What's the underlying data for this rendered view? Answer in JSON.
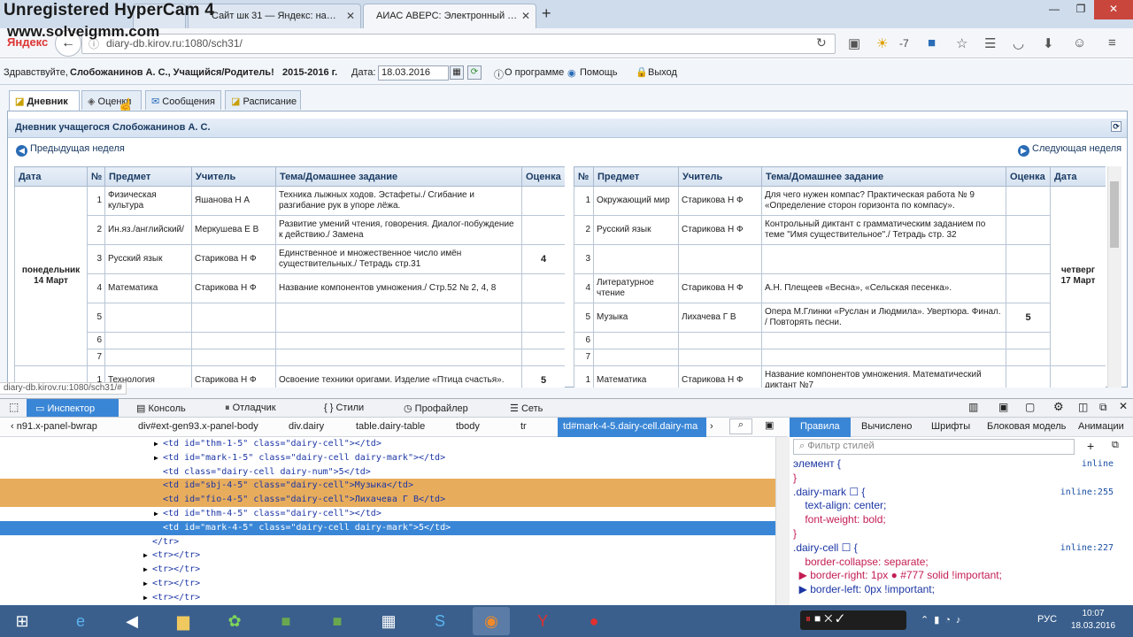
{
  "watermark": {
    "line1": "Unregistered HyperCam 4",
    "line2": "www.solveigmm.com"
  },
  "browser": {
    "tabs": [
      {
        "label": "",
        "active": false
      },
      {
        "label": "Сайт шк 31 — Яндекс: на…",
        "active": false
      },
      {
        "label": "АИАС АВЕРС: Электронный …",
        "active": true
      }
    ],
    "new_tab": "+",
    "url": "diary-db.kirov.ru:1080/sch31/",
    "weather_temp": "-7",
    "yandex_label": "Яндекс"
  },
  "app": {
    "greeting_prefix": "Здравствуйте,",
    "user": "Слобожанинов А. С., Учащийся/Родитель!",
    "year": "2015-2016 г.",
    "date_label": "Дата:",
    "date_value": "18.03.2016",
    "about": "О программе",
    "help": "Помощь",
    "logout": "Выход",
    "tabs": [
      "Дневник",
      "Оценки",
      "Сообщения",
      "Расписание"
    ],
    "panel_title": "Дневник учащегося Слобожанинов А. С.",
    "prev_week": "Предыдущая неделя",
    "next_week": "Следующая неделя",
    "status_url": "diary-db.kirov.ru:1080/sch31/#"
  },
  "diary_left": {
    "headers": [
      "Дата",
      "№",
      "Предмет",
      "Учитель",
      "Тема/Домашнее задание",
      "Оценка"
    ],
    "day": "понедельник\n14 Март",
    "rows": [
      {
        "n": "1",
        "subject": "Физическая культура",
        "teacher": "Яшанова Н А",
        "topic": "Техника лыжных ходов. Эстафеты./ Сгибание и разгибание рук в упоре лёжа.",
        "mark": ""
      },
      {
        "n": "2",
        "subject": "Ин.яз./английский/",
        "teacher": "Меркушева Е В",
        "topic": "Развитие умений чтения, говорения. Диалог-побуждение к действию./ Замена",
        "mark": ""
      },
      {
        "n": "3",
        "subject": "Русский язык",
        "teacher": "Старикова Н Ф",
        "topic": "Единственное и множественное число имён существительных./ Тетрадь стр.31",
        "mark": "4"
      },
      {
        "n": "4",
        "subject": "Математика",
        "teacher": "Старикова Н Ф",
        "topic": "Название компонентов умножения./ Стр.52 № 2, 4, 8",
        "mark": ""
      },
      {
        "n": "5",
        "subject": "",
        "teacher": "",
        "topic": "",
        "mark": ""
      },
      {
        "n": "6",
        "subject": "",
        "teacher": "",
        "topic": "",
        "mark": ""
      },
      {
        "n": "7",
        "subject": "",
        "teacher": "",
        "topic": "",
        "mark": ""
      }
    ],
    "next_row": {
      "n": "1",
      "subject": "Технология",
      "teacher": "Старикова Н Ф",
      "topic": "Освоение техники оригами. Изделие «Птица счастья».",
      "mark": "5"
    }
  },
  "diary_right": {
    "headers": [
      "№",
      "Предмет",
      "Учитель",
      "Тема/Домашнее задание",
      "Оценка",
      "Дата"
    ],
    "day": "четверг\n17 Март",
    "rows": [
      {
        "n": "1",
        "subject": "Окружающий мир",
        "teacher": "Старикова Н Ф",
        "topic": "Для чего нужен компас? Практическая работа № 9 «Определение сторон горизонта по компасу».",
        "mark": ""
      },
      {
        "n": "2",
        "subject": "Русский язык",
        "teacher": "Старикова Н Ф",
        "topic": "Контрольный диктант с грамматическим заданием по теме \"Имя существительное\"./ Тетрадь стр. 32",
        "mark": ""
      },
      {
        "n": "3",
        "subject": "",
        "teacher": "",
        "topic": "",
        "mark": ""
      },
      {
        "n": "4",
        "subject": "Литературное чтение",
        "teacher": "Старикова Н Ф",
        "topic": "А.Н. Плещеев «Весна», «Сельская песенка».",
        "mark": ""
      },
      {
        "n": "5",
        "subject": "Музыка",
        "teacher": "Лихачева Г В",
        "topic": "Опера М.Глинки «Руслан и Людмила». Увертюра. Финал. / Повторять песни.",
        "mark": "5"
      },
      {
        "n": "6",
        "subject": "",
        "teacher": "",
        "topic": "",
        "mark": ""
      },
      {
        "n": "7",
        "subject": "",
        "teacher": "",
        "topic": "",
        "mark": ""
      }
    ],
    "next_row": {
      "n": "1",
      "subject": "Математика",
      "teacher": "Старикова Н Ф",
      "topic": "Название компонентов умножения. Математический диктант №7",
      "mark": ""
    }
  },
  "devtools": {
    "tabs": [
      "Инспектор",
      "Консоль",
      "Отладчик",
      "Стили",
      "Профайлер",
      "Сеть"
    ],
    "breadcrumbs": [
      "n91.x-panel-bwrap",
      "div#ext-gen93.x-panel-body",
      "div.dairy",
      "table.dairy-table",
      "tbody",
      "tr",
      "td#mark-4-5.dairy-cell.dairy-ma"
    ],
    "html_lines": [
      {
        "indent": 2,
        "arrow": "▶",
        "text": "<td id=\"thm-1-5\" class=\"dairy-cell\"></td>",
        "style": ""
      },
      {
        "indent": 2,
        "arrow": "▶",
        "text": "<td id=\"mark-1-5\" class=\"dairy-cell dairy-mark\"></td>",
        "style": ""
      },
      {
        "indent": 2,
        "arrow": "",
        "text": "<td class=\"dairy-cell dairy-num\">5</td>",
        "style": ""
      },
      {
        "indent": 2,
        "arrow": "",
        "text": "<td id=\"sbj-4-5\" class=\"dairy-cell\">Музыка</td>",
        "style": "orange"
      },
      {
        "indent": 2,
        "arrow": "",
        "text": "<td id=\"fio-4-5\" class=\"dairy-cell\">Лихачева Г В</td>",
        "style": "orange"
      },
      {
        "indent": 2,
        "arrow": "▶",
        "text": "<td id=\"thm-4-5\" class=\"dairy-cell\"></td>",
        "style": ""
      },
      {
        "indent": 2,
        "arrow": "",
        "text": "<td id=\"mark-4-5\" class=\"dairy-cell dairy-mark\">5</td>",
        "style": "blue"
      },
      {
        "indent": 1,
        "arrow": "",
        "text": "</tr>",
        "style": ""
      },
      {
        "indent": 1,
        "arrow": "▶",
        "text": "<tr></tr>",
        "style": ""
      },
      {
        "indent": 1,
        "arrow": "▶",
        "text": "<tr></tr>",
        "style": ""
      },
      {
        "indent": 1,
        "arrow": "▶",
        "text": "<tr></tr>",
        "style": ""
      },
      {
        "indent": 1,
        "arrow": "▶",
        "text": "<tr></tr>",
        "style": ""
      }
    ],
    "right_tabs": [
      "Правила",
      "Вычислено",
      "Шрифты",
      "Блоковая модель",
      "Анимации"
    ],
    "filter_placeholder": "Фильтр стилей",
    "css_lines": [
      {
        "text": "элемент {",
        "ref": "inline"
      },
      {
        "text": "}",
        "ref": ""
      },
      {
        "text": ".dairy-mark ☐ {",
        "ref": "inline:255"
      },
      {
        "text": "    text-align: center;",
        "ref": ""
      },
      {
        "text": "    font-weight: bold;",
        "ref": ""
      },
      {
        "text": "}",
        "ref": ""
      },
      {
        "text": ".dairy-cell ☐ {",
        "ref": "inline:227"
      },
      {
        "text": "    border-collapse: separate;",
        "ref": ""
      },
      {
        "text": "  ▶ border-right: 1px ● #777 solid !important;",
        "ref": ""
      },
      {
        "text": "  ▶ border-left: 0px !important;",
        "ref": ""
      }
    ]
  },
  "taskbar": {
    "lang": "РУС",
    "time": "10:07",
    "date": "18.03.2016"
  },
  "colors": {
    "accent": "#3a86d6",
    "highlight_orange": "#e8ad5c",
    "panel_header": "#1b3b63"
  }
}
